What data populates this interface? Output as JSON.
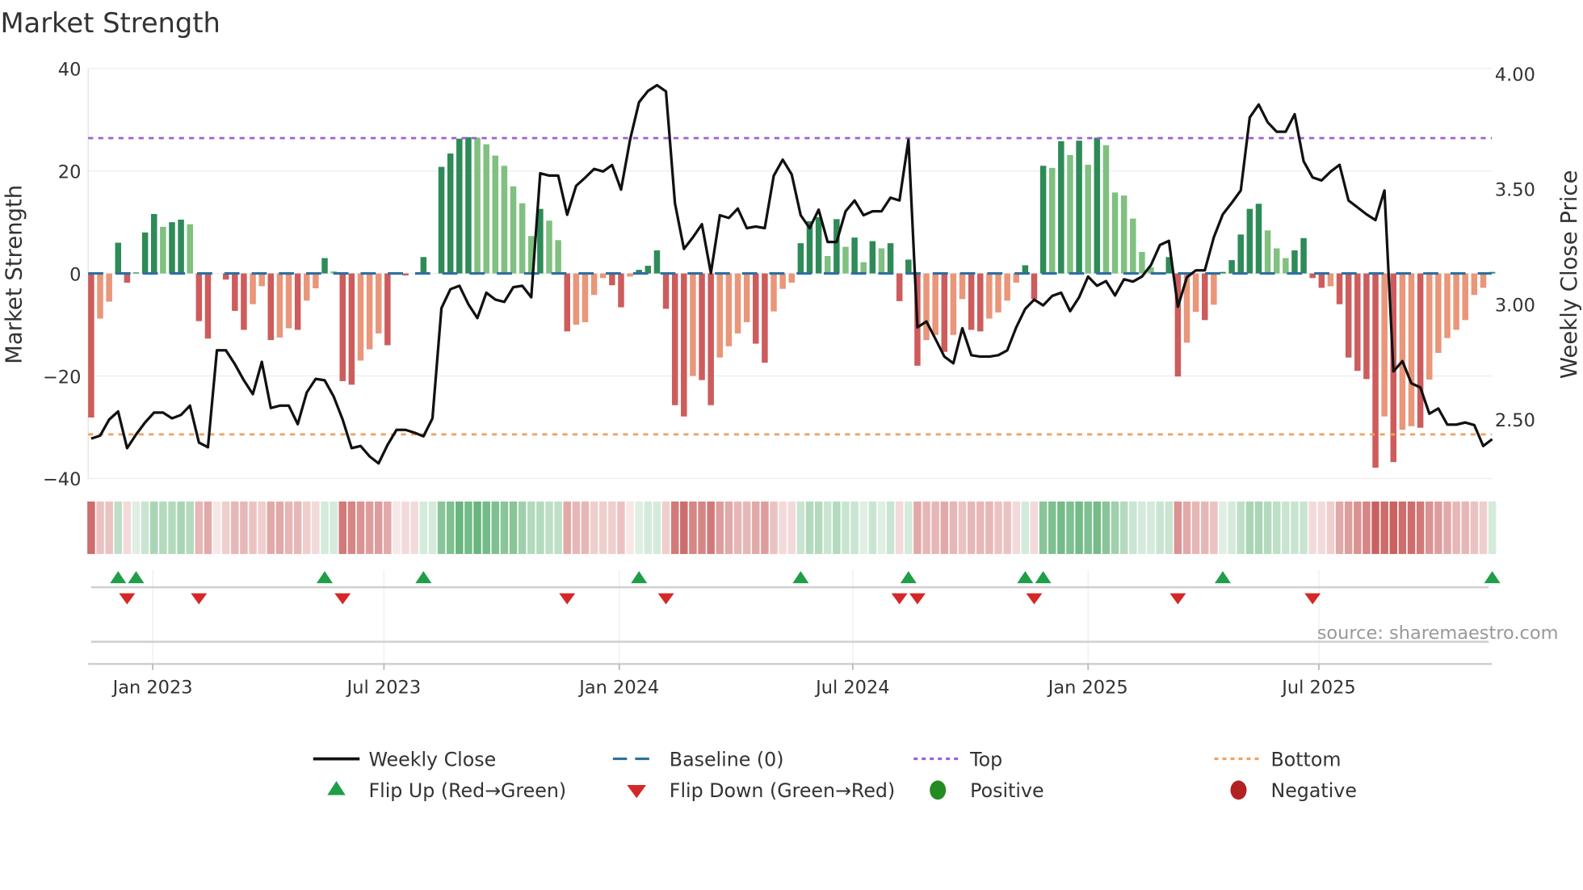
{
  "chart_data": {
    "type": "bar",
    "title": "Market Strength",
    "ylabel": "Market Strength",
    "ylabel_right": "Weekly Close Price",
    "ylim": [
      -40,
      40
    ],
    "ylim_right_ticks": [
      2.5,
      3.0,
      3.5,
      4.0
    ],
    "yticks": [
      {
        "v": 40,
        "label": "40"
      },
      {
        "v": 20,
        "label": "20"
      },
      {
        "v": 0,
        "label": "0"
      },
      {
        "v": -20,
        "label": "−20"
      },
      {
        "v": -40,
        "label": "−40"
      }
    ],
    "yticks_right": [
      {
        "v": 4.0,
        "label": "4.00"
      },
      {
        "v": 3.5,
        "label": "3.50"
      },
      {
        "v": 3.0,
        "label": "3.00"
      },
      {
        "v": 2.5,
        "label": "2.50"
      }
    ],
    "xticks": [
      {
        "week": 6.85,
        "label": "Jan 2023"
      },
      {
        "week": 32.6,
        "label": "Jul 2023"
      },
      {
        "week": 58.8,
        "label": "Jan 2024"
      },
      {
        "week": 84.8,
        "label": "Jul 2024"
      },
      {
        "week": 111.0,
        "label": "Jan 2025"
      },
      {
        "week": 136.7,
        "label": "Jul 2025"
      }
    ],
    "grid": true,
    "top_level": 26.4,
    "bottom_level": -31.4,
    "baseline": 0,
    "strength": [
      -28.1,
      -8.8,
      -5.5,
      6,
      -1.8,
      0.2,
      8,
      11.6,
      9.1,
      10,
      10.5,
      9.6,
      -9.3,
      -12.7,
      0,
      -1.2,
      -7.3,
      -11,
      -6,
      -2.5,
      -13,
      -12.5,
      -10.7,
      -11,
      -5.3,
      -2.9,
      3.0,
      0.4,
      -21,
      -21.7,
      -17,
      -14.8,
      -11.7,
      -14,
      -0.2,
      -0.4,
      0,
      3.2,
      0,
      20.8,
      23.4,
      26.3,
      26.6,
      26.5,
      25.2,
      23,
      21,
      17,
      13.7,
      7.3,
      12.6,
      10.3,
      6.5,
      -11.3,
      -10,
      -9.5,
      -4.2,
      -0.9,
      -2.3,
      -6.6,
      -0.6,
      0.7,
      1.5,
      4.5,
      -6.9,
      -25.7,
      -27.9,
      -20,
      -20.8,
      -25.7,
      -16.4,
      -14.2,
      -11.7,
      -9.5,
      -13.7,
      -17.4,
      -7.4,
      -3,
      -1.8,
      5.9,
      10.2,
      11,
      3.4,
      10.6,
      5.2,
      7,
      2.2,
      6.3,
      4.9,
      5.9,
      -5.4,
      2.7,
      -18,
      -13,
      -12,
      -15.3,
      -12,
      -5,
      -11,
      -11.3,
      -8.8,
      -7.6,
      -5.3,
      -1.8,
      1.6,
      -5,
      21,
      20.6,
      25.8,
      23.1,
      25.9,
      21.2,
      26.5,
      25,
      15.8,
      15.2,
      10.7,
      4.2,
      1.2,
      0.2,
      3.2,
      -20.1,
      -13.5,
      -7.5,
      -9.1,
      -6.1,
      0.3,
      2.6,
      7.6,
      12.6,
      13.6,
      8.4,
      4.9,
      3,
      4.5,
      6.9,
      -0.9,
      -2.8,
      -2.5,
      -6,
      -16.4,
      -19,
      -20.6,
      -37.9,
      -27.9,
      -36.8,
      -30.5,
      -29.8,
      -30.1,
      -20.7,
      -15.5,
      -12.6,
      -11,
      -9.1,
      -4.2,
      -2.8,
      0.3
    ],
    "weekly_close": [
      2.417,
      2.43,
      2.5,
      2.535,
      2.376,
      2.435,
      2.487,
      2.53,
      2.53,
      2.505,
      2.52,
      2.56,
      2.4,
      2.38,
      2.8,
      2.8,
      2.74,
      2.67,
      2.61,
      2.75,
      2.55,
      2.56,
      2.56,
      2.48,
      2.617,
      2.676,
      2.67,
      2.6,
      2.5,
      2.376,
      2.385,
      2.34,
      2.31,
      2.39,
      2.455,
      2.455,
      2.443,
      2.427,
      2.505,
      2.983,
      3.065,
      3.08,
      3.0,
      2.94,
      3.05,
      3.02,
      3.01,
      3.074,
      3.08,
      3.03,
      3.568,
      3.558,
      3.558,
      3.388,
      3.514,
      3.549,
      3.587,
      3.576,
      3.604,
      3.497,
      3.713,
      3.876,
      3.925,
      3.95,
      3.923,
      3.438,
      3.24,
      3.29,
      3.347,
      3.135,
      3.386,
      3.374,
      3.415,
      3.33,
      3.337,
      3.33,
      3.557,
      3.627,
      3.563,
      3.386,
      3.33,
      3.41,
      3.27,
      3.27,
      3.403,
      3.45,
      3.386,
      3.403,
      3.403,
      3.462,
      3.45,
      3.713,
      2.9,
      2.925,
      2.85,
      2.773,
      2.744,
      2.896,
      2.779,
      2.773,
      2.773,
      2.779,
      2.8,
      2.9,
      2.98,
      3.02,
      2.995,
      3.036,
      3.05,
      2.97,
      3.03,
      3.12,
      3.08,
      3.1,
      3.038,
      3.108,
      3.098,
      3.12,
      3.17,
      3.257,
      3.275,
      2.989,
      3.117,
      3.147,
      3.147,
      3.29,
      3.39,
      3.44,
      3.493,
      3.81,
      3.866,
      3.789,
      3.748,
      3.748,
      3.824,
      3.62,
      3.55,
      3.537,
      3.575,
      3.605,
      3.45,
      3.42,
      3.39,
      3.365,
      3.493,
      2.709,
      2.753,
      2.657,
      2.639,
      2.525,
      2.548,
      2.478,
      2.478,
      2.487,
      2.476,
      2.385,
      2.415
    ],
    "regime_strip": [
      -0.6,
      -0.25,
      -0.25,
      0.3,
      -0.15,
      0.15,
      0.25,
      0.4,
      0.35,
      0.35,
      0.4,
      0.35,
      -0.3,
      -0.35,
      -0.1,
      -0.2,
      -0.3,
      -0.3,
      -0.25,
      -0.2,
      -0.35,
      -0.35,
      -0.3,
      -0.3,
      -0.2,
      -0.15,
      0.2,
      0.2,
      -0.55,
      -0.5,
      -0.45,
      -0.4,
      -0.4,
      -0.35,
      -0.1,
      -0.15,
      -0.15,
      0.2,
      0.2,
      0.55,
      0.6,
      0.7,
      0.65,
      0.7,
      0.65,
      0.6,
      0.55,
      0.55,
      0.45,
      0.35,
      0.35,
      0.3,
      0.3,
      -0.35,
      -0.3,
      -0.3,
      -0.2,
      -0.2,
      -0.2,
      -0.25,
      -0.1,
      0.15,
      0.2,
      0.2,
      -0.2,
      -0.55,
      -0.6,
      -0.5,
      -0.5,
      -0.55,
      -0.4,
      -0.35,
      -0.3,
      -0.3,
      -0.35,
      -0.4,
      -0.25,
      -0.15,
      -0.15,
      0.25,
      0.35,
      0.35,
      0.25,
      0.35,
      0.25,
      0.25,
      0.15,
      0.25,
      0.15,
      0.25,
      -0.15,
      0.2,
      -0.35,
      -0.3,
      -0.3,
      -0.35,
      -0.3,
      -0.25,
      -0.3,
      -0.3,
      -0.3,
      -0.25,
      -0.25,
      -0.15,
      0.2,
      -0.15,
      0.55,
      0.6,
      0.65,
      0.6,
      0.65,
      0.6,
      0.65,
      0.55,
      0.45,
      0.35,
      0.25,
      0.2,
      0.2,
      0.25,
      0.25,
      -0.45,
      -0.35,
      -0.3,
      -0.3,
      -0.25,
      0.15,
      0.2,
      0.3,
      0.4,
      0.4,
      0.35,
      0.3,
      0.25,
      0.25,
      0.25,
      -0.15,
      -0.15,
      -0.2,
      -0.35,
      -0.4,
      -0.45,
      -0.5,
      -0.65,
      -0.6,
      -0.65,
      -0.6,
      -0.6,
      -0.55,
      -0.45,
      -0.4,
      -0.35,
      -0.3,
      -0.3,
      -0.25,
      -0.2,
      0.2
    ],
    "flip_up_weeks": [
      3,
      5,
      26,
      37,
      61,
      79,
      91,
      104,
      106,
      126,
      156
    ],
    "flip_down_weeks": [
      4,
      12,
      28,
      53,
      64,
      90,
      92,
      105,
      121,
      136
    ],
    "legend_placement": "bottom"
  },
  "title": "Market Strength",
  "axis": {
    "left_title": "Market Strength",
    "right_title": "Weekly Close Price"
  },
  "source": "source: sharemaestro.com",
  "legend": {
    "weekly_close": "Weekly Close",
    "baseline": "Baseline (0)",
    "top": "Top",
    "bottom": "Bottom",
    "flip_up": "Flip Up (Red→Green)",
    "flip_down": "Flip Down (Green→Red)",
    "positive": "Positive",
    "negative": "Negative"
  },
  "colors": {
    "bar_pos_strong": "#2e8b57",
    "bar_pos_weak": "#80c080",
    "bar_neg_strong": "#cd5c5c",
    "bar_neg_weak": "#e9967a",
    "baseline": "#2f6f9f",
    "top": "#9b5fd6",
    "bottom": "#f0a060",
    "close": "#111111",
    "flip_up": "#1f9e48",
    "flip_down": "#d62728",
    "positive": "#228b22",
    "negative": "#b22222"
  }
}
